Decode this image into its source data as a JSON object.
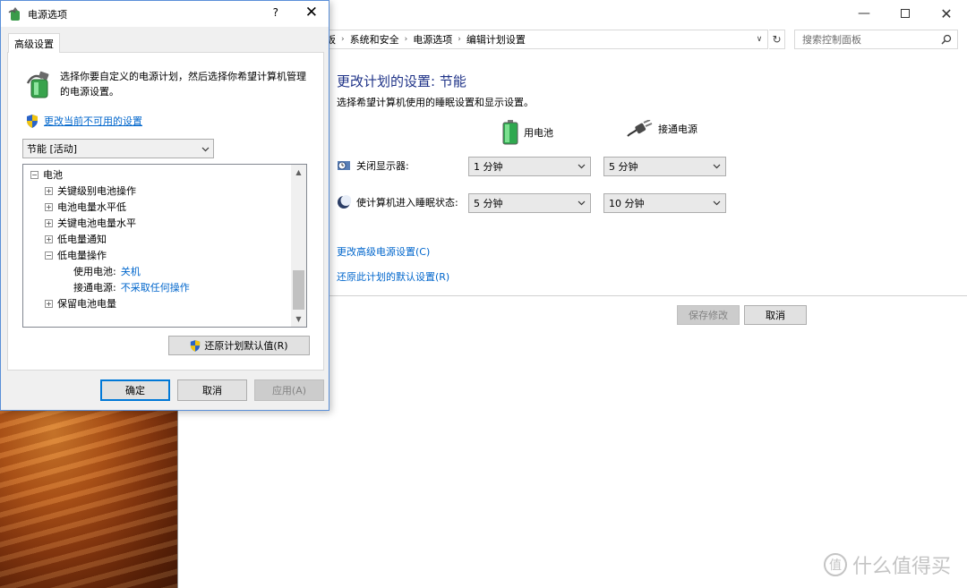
{
  "control_panel": {
    "breadcrumb": [
      "板",
      "系统和安全",
      "电源选项",
      "编辑计划设置"
    ],
    "search_placeholder": "搜索控制面板",
    "title": "更改计划的设置: 节能",
    "subtitle": "选择希望计算机使用的睡眠设置和显示设置。",
    "columns": {
      "battery": "用电池",
      "plugged": "接通电源"
    },
    "rows": [
      {
        "label": "关闭显示器:",
        "battery": "1 分钟",
        "plugged": "5 分钟"
      },
      {
        "label": "使计算机进入睡眠状态:",
        "battery": "5 分钟",
        "plugged": "10 分钟"
      }
    ],
    "links": {
      "advanced": "更改高级电源设置(C)",
      "restore": "还原此计划的默认设置(R)"
    },
    "buttons": {
      "save": "保存修改",
      "cancel": "取消"
    }
  },
  "dialog": {
    "title": "电源选项",
    "help_glyph": "?",
    "tab": "高级设置",
    "intro": "选择你要自定义的电源计划，然后选择你希望计算机管理的电源设置。",
    "unavailable_link": "更改当前不可用的设置",
    "plan_selected": "节能 [活动]",
    "tree": {
      "root": "电池",
      "items": [
        "关键级别电池操作",
        "电池电量水平低",
        "关键电池电量水平",
        "低电量通知",
        "低电量操作"
      ],
      "on_battery_label": "使用电池:",
      "on_battery_value": "关机",
      "plugged_label": "接通电源:",
      "plugged_value": "不采取任何操作",
      "last": "保留电池电量"
    },
    "restore_button": "还原计划默认值(R)",
    "ok": "确定",
    "cancel": "取消",
    "apply": "应用(A)"
  },
  "watermark": "什么值得买",
  "colors": {
    "link": "#0066cc",
    "title": "#1e3287",
    "accent": "#0078d7"
  }
}
